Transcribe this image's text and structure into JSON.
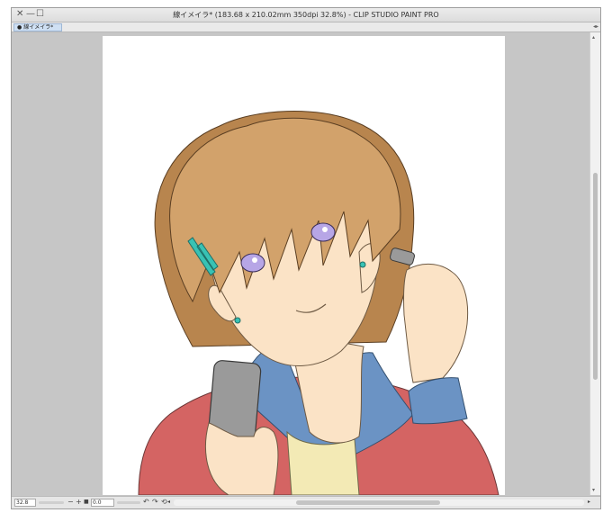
{
  "window": {
    "title": "線イメイラ* (183.68 x 210.02mm 350dpi 32.8%)  - CLIP STUDIO PAINT PRO",
    "controls": {
      "close": "✕",
      "minimize": "—",
      "maximize": "☐"
    }
  },
  "tab": {
    "label": "線イメイラ*",
    "dot": "●",
    "scroll": "◂▸"
  },
  "status": {
    "zoom": "32.8",
    "zoom_out": "−",
    "zoom_in": "+",
    "fit": "■",
    "rotation": "0.0",
    "rotate_left": "↶",
    "rotate_right": "↷",
    "reset_rotation": "⟲",
    "scroll_left": "◂",
    "scroll_right": "▸"
  },
  "colors": {
    "hair": "#d2a26b",
    "hair_shadow": "#b8854e",
    "skin": "#fbe3c6",
    "jacket": "#d46463",
    "shirt": "#6b93c4",
    "tank": "#f3eab5",
    "phone": "#9a9a9a",
    "eye": "#b7a6e6",
    "clip": "#38c2b4",
    "canvas_bg": "#c6c6c6"
  }
}
